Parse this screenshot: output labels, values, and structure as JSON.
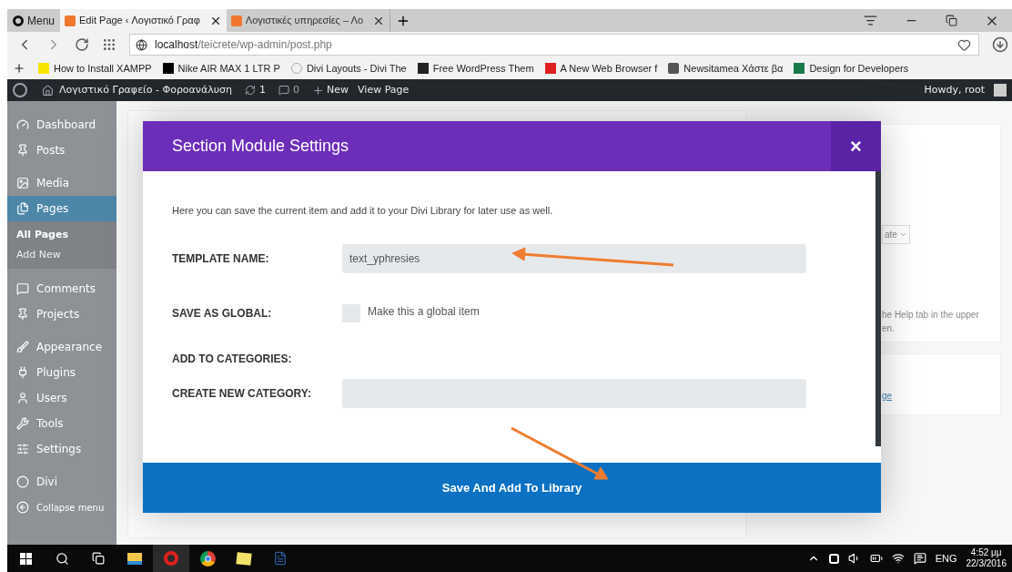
{
  "browser": {
    "menu": "Menu",
    "tabs": [
      {
        "title": "Edit Page ‹ Λογιστικό Γραφ",
        "selected": true
      },
      {
        "title": "Λογιστικές υπηρεσίες – Λο",
        "selected": false
      }
    ],
    "address": {
      "host": "localhost",
      "path": "/teicrete/wp-admin/post.php"
    },
    "bookmarks": [
      "How to Install XAMPP",
      "Nike AIR MAX 1 LTR P",
      "Divi Layouts - Divi The",
      "Free WordPress Them",
      "A New Web Browser f",
      "Newsitamea Χάστε βα",
      "Design for Developers"
    ]
  },
  "admin_bar": {
    "site": "Λογιστικό Γραφείο - Φοροανάλυση",
    "updates": "1",
    "comments": "0",
    "new": "New",
    "view": "View Page",
    "howdy": "Howdy, root"
  },
  "sidebar": {
    "items": [
      {
        "label": "Dashboard",
        "selected": false
      },
      {
        "label": "Posts",
        "selected": false
      },
      {
        "label": "Media",
        "selected": false
      },
      {
        "label": "Pages",
        "selected": true,
        "children": [
          {
            "label": "All Pages",
            "selected": true
          },
          {
            "label": "Add New",
            "selected": false
          }
        ]
      },
      {
        "label": "Comments",
        "selected": false
      },
      {
        "label": "Projects",
        "selected": false
      },
      {
        "label": "Appearance",
        "selected": false
      },
      {
        "label": "Plugins",
        "selected": false
      },
      {
        "label": "Users",
        "selected": false
      },
      {
        "label": "Tools",
        "selected": false
      },
      {
        "label": "Settings",
        "selected": false
      },
      {
        "label": "Divi",
        "selected": false
      },
      {
        "label": "Collapse menu",
        "selected": false
      }
    ]
  },
  "background_panel": {
    "select_text": "ate",
    "help_line_1": "he Help tab in the upper",
    "help_line_2": "en.",
    "link": "ge"
  },
  "modal": {
    "title": "Section Module Settings",
    "close": "×",
    "intro": "Here you can save the current item and add it to your Divi Library for later use as well.",
    "fields": [
      {
        "kind": "text",
        "label": "TEMPLATE NAME:",
        "value": "text_yphresies"
      },
      {
        "kind": "checkbox",
        "label": "SAVE AS GLOBAL:",
        "option": "Make this a global item",
        "checked": false
      },
      {
        "kind": "heading",
        "label": "ADD TO CATEGORIES:"
      },
      {
        "kind": "text",
        "label": "CREATE NEW CATEGORY:"
      }
    ],
    "button": "Save And Add To Library"
  },
  "taskbar": {
    "language": "ENG",
    "time": "4:52 μμ",
    "date": "22/3/2016"
  }
}
